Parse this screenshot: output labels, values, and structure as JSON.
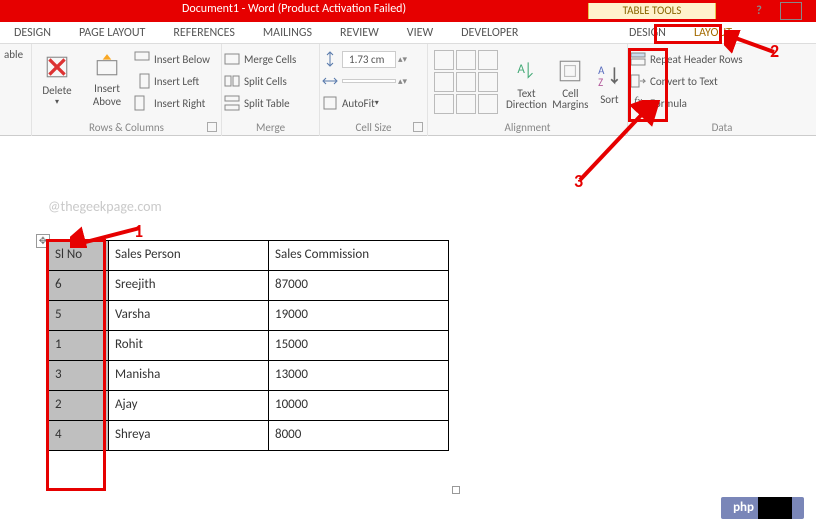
{
  "title": "Document1 -  Word (Product Activation Failed)",
  "tools_tab": "TABLE TOOLS",
  "tabs": {
    "design": "DESIGN",
    "page_layout": "PAGE LAYOUT",
    "references": "REFERENCES",
    "mailings": "MAILINGS",
    "review": "REVIEW",
    "view": "VIEW",
    "developer": "DEVELOPER",
    "design2": "DESIGN",
    "layout2": "LAYOUT"
  },
  "ribbon": {
    "table_group": {
      "able_fragment": "able"
    },
    "rowscols": {
      "delete": "Delete",
      "insert_above": "Insert Above",
      "insert_below": "Insert Below",
      "insert_left": "Insert Left",
      "insert_right": "Insert Right",
      "label": "Rows & Columns"
    },
    "merge": {
      "merge_cells": "Merge Cells",
      "split_cells": "Split Cells",
      "split_table": "Split Table",
      "label": "Merge"
    },
    "cellsize": {
      "height_value": "1.73 cm",
      "autofit": "AutoFit",
      "label": "Cell Size"
    },
    "alignment": {
      "text_direction": "Text Direction",
      "cell_margins": "Cell Margins",
      "sort": "Sort",
      "label": "Alignment"
    },
    "data": {
      "repeat_header": "Repeat Header Rows",
      "convert_text": "Convert to Text",
      "formula": "Formula",
      "label": "Data"
    }
  },
  "watermark": "@thegeekpage.com",
  "table_headers": {
    "c1": "Sl No",
    "c2": "Sales Person",
    "c3": "Sales Commission"
  },
  "table_rows": [
    {
      "c1": "6",
      "c2": "Sreejith",
      "c3": "87000"
    },
    {
      "c1": "5",
      "c2": "Varsha",
      "c3": "19000"
    },
    {
      "c1": "1",
      "c2": "Rohit",
      "c3": "15000"
    },
    {
      "c1": "3",
      "c2": "Manisha",
      "c3": "13000"
    },
    {
      "c1": "2",
      "c2": "Ajay",
      "c3": "10000"
    },
    {
      "c1": "4",
      "c2": "Shreya",
      "c3": "8000"
    }
  ],
  "annotations": {
    "n1": "1",
    "n2": "2",
    "n3": "3"
  },
  "badge": "php"
}
